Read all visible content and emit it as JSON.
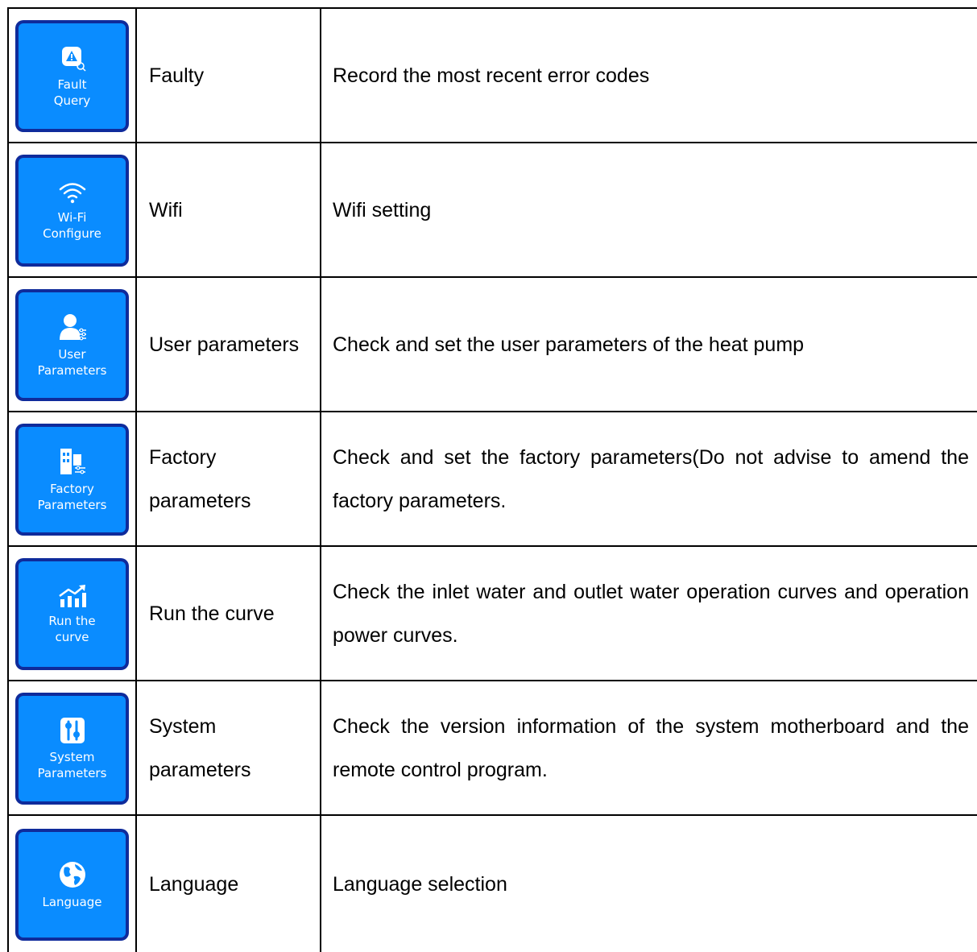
{
  "rows": [
    {
      "icon": "fault-warning-icon",
      "tile_label": "Fault\nQuery",
      "name": "Faulty",
      "description": "Record the most recent error codes"
    },
    {
      "icon": "wifi-icon",
      "tile_label": "Wi-Fi\nConfigure",
      "name": "Wifi",
      "description": "Wifi setting"
    },
    {
      "icon": "user-settings-icon",
      "tile_label": "User\nParameters",
      "name": "User parameters",
      "description": "Check and set the user parameters of the heat pump"
    },
    {
      "icon": "factory-settings-icon",
      "tile_label": "Factory\nParameters",
      "name": "Factory parameters",
      "description": "Check and set the factory parameters(Do not advise to amend the factory parameters."
    },
    {
      "icon": "rising-chart-icon",
      "tile_label": "Run the\ncurve",
      "name": "Run the curve",
      "description": "Check the inlet water and outlet water operation curves and operation power curves."
    },
    {
      "icon": "system-sliders-icon",
      "tile_label": "System\nParameters",
      "name": "System parameters",
      "description": "Check the version information of the system motherboard and the remote control program."
    },
    {
      "icon": "globe-icon",
      "tile_label": "Language",
      "name": "Language",
      "description": "Language selection"
    }
  ],
  "colors": {
    "tile_fill": "#0a8cff",
    "tile_border": "#0f2b9b",
    "text": "#000000"
  }
}
